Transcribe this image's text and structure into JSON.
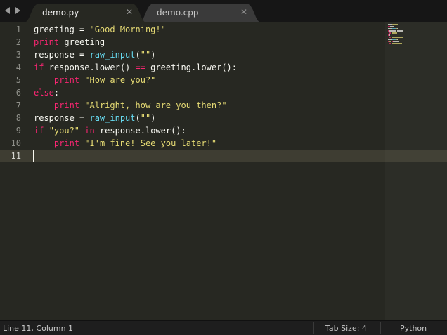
{
  "tabs": [
    {
      "label": "demo.py",
      "close": "✕",
      "active": true
    },
    {
      "label": "demo.cpp",
      "close": "✕",
      "active": false
    }
  ],
  "editor": {
    "line_numbers": [
      "1",
      "2",
      "3",
      "4",
      "5",
      "6",
      "7",
      "8",
      "9",
      "10",
      "11"
    ],
    "current_line": 11,
    "lines": [
      [
        {
          "t": "pl",
          "v": "greeting = "
        },
        {
          "t": "str",
          "v": "\"Good Morning!\""
        }
      ],
      [
        {
          "t": "kw",
          "v": "print"
        },
        {
          "t": "pl",
          "v": " greeting"
        }
      ],
      [
        {
          "t": "pl",
          "v": "response = "
        },
        {
          "t": "fn",
          "v": "raw_input"
        },
        {
          "t": "pl",
          "v": "("
        },
        {
          "t": "str",
          "v": "\"\""
        },
        {
          "t": "pl",
          "v": ")"
        }
      ],
      [
        {
          "t": "kw",
          "v": "if"
        },
        {
          "t": "pl",
          "v": " response.lower() "
        },
        {
          "t": "kw",
          "v": "=="
        },
        {
          "t": "pl",
          "v": " greeting.lower():"
        }
      ],
      [
        {
          "t": "pl",
          "v": "    "
        },
        {
          "t": "kw",
          "v": "print"
        },
        {
          "t": "pl",
          "v": " "
        },
        {
          "t": "str",
          "v": "\"How are you?\""
        }
      ],
      [
        {
          "t": "kw",
          "v": "else"
        },
        {
          "t": "pl",
          "v": ":"
        }
      ],
      [
        {
          "t": "pl",
          "v": "    "
        },
        {
          "t": "kw",
          "v": "print"
        },
        {
          "t": "pl",
          "v": " "
        },
        {
          "t": "str",
          "v": "\"Alright, how are you then?\""
        }
      ],
      [
        {
          "t": "pl",
          "v": "response = "
        },
        {
          "t": "fn",
          "v": "raw_input"
        },
        {
          "t": "pl",
          "v": "("
        },
        {
          "t": "str",
          "v": "\"\""
        },
        {
          "t": "pl",
          "v": ")"
        }
      ],
      [
        {
          "t": "kw",
          "v": "if"
        },
        {
          "t": "pl",
          "v": " "
        },
        {
          "t": "str",
          "v": "\"you?\""
        },
        {
          "t": "pl",
          "v": " "
        },
        {
          "t": "kw",
          "v": "in"
        },
        {
          "t": "pl",
          "v": " response.lower():"
        }
      ],
      [
        {
          "t": "pl",
          "v": "    "
        },
        {
          "t": "kw",
          "v": "print"
        },
        {
          "t": "pl",
          "v": " "
        },
        {
          "t": "str",
          "v": "\"I'm fine! See you later!\""
        }
      ],
      []
    ]
  },
  "statusbar": {
    "position": "Line 11, Column 1",
    "tab_size": "Tab Size: 4",
    "syntax": "Python"
  },
  "colors": {
    "background": "#272822",
    "keyword": "#f92672",
    "string": "#e6db74",
    "function": "#66d9ef",
    "plain": "#f8f8f2"
  },
  "icons": [
    "nav-left-icon",
    "nav-right-icon",
    "close-icon"
  ]
}
